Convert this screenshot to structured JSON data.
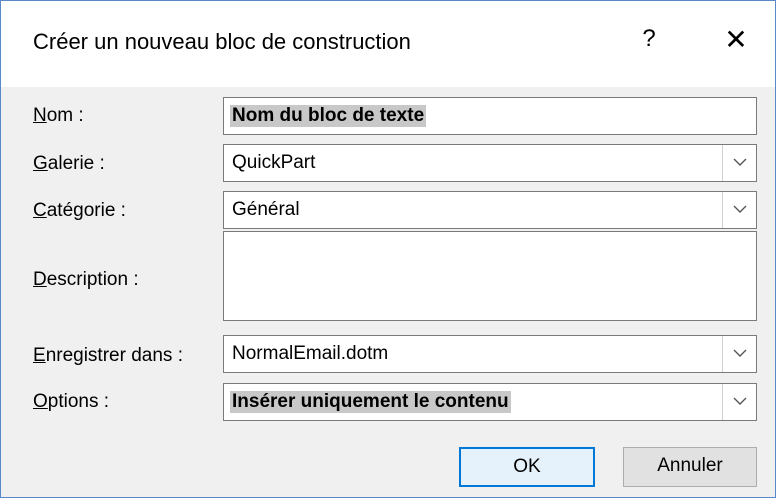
{
  "dialog": {
    "title": "Créer un nouveau bloc de construction",
    "help_glyph": "?",
    "close_glyph": "✕"
  },
  "fields": {
    "name": {
      "label_first": "N",
      "label_rest": "om :",
      "value": "Nom du bloc de texte"
    },
    "gallery": {
      "label_first": "G",
      "label_rest": "alerie :",
      "value": "QuickPart"
    },
    "category": {
      "label_first": "C",
      "label_rest": "atégorie :",
      "value": "Général"
    },
    "description": {
      "label_first": "D",
      "label_rest": "escription :",
      "value": ""
    },
    "save_in": {
      "label_first": "E",
      "label_rest": "nregistrer dans :",
      "value": "NormalEmail.dotm"
    },
    "options": {
      "label_first": "O",
      "label_rest": "ptions :",
      "value": "Insérer uniquement le contenu"
    }
  },
  "buttons": {
    "ok": "OK",
    "cancel": "Annuler"
  },
  "colors": {
    "accent": "#0078d7",
    "selection": "#c8c8c8"
  }
}
